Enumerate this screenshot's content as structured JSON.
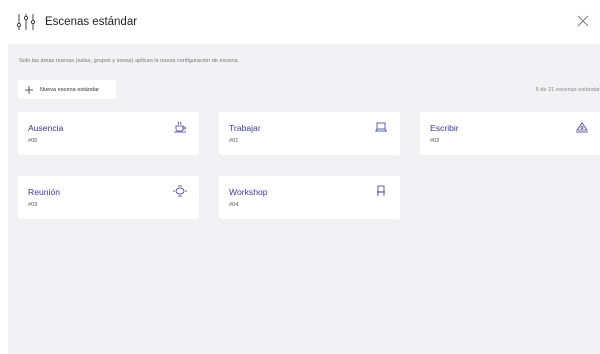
{
  "header": {
    "title": "Escenas estándar",
    "icon": "sliders-icon",
    "close_icon": "close-icon"
  },
  "notice": "Solo las áreas nuevas (salas, grupos y zonas) aplican la nueva configuración de escena.",
  "new_button": {
    "label": "Nueva escena estándar",
    "icon": "plus-icon"
  },
  "count": "5 de 21 escenas estándar",
  "scenes": [
    {
      "name": "Ausencia",
      "number": "#00",
      "icon": "coffee-cup-icon"
    },
    {
      "name": "Trabajar",
      "number": "#01",
      "icon": "laptop-icon"
    },
    {
      "name": "Escribir",
      "number": "#02",
      "icon": "pen-tip-icon"
    },
    {
      "name": "Reunión",
      "number": "#03",
      "icon": "meeting-table-icon"
    },
    {
      "name": "Workshop",
      "number": "#04",
      "icon": "chair-icon"
    }
  ],
  "colors": {
    "accent": "#3a3a9a",
    "background": "#f2f2f4",
    "card": "#ffffff"
  }
}
